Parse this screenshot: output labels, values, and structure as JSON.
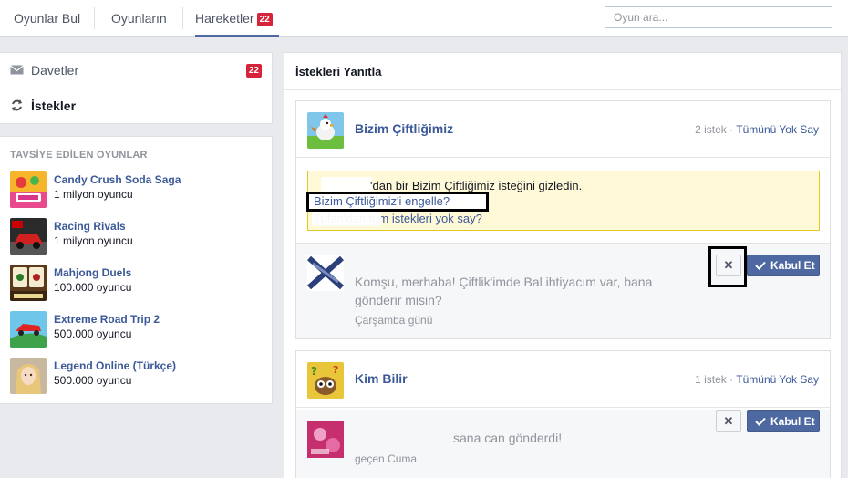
{
  "tabs": {
    "find_games": "Oyunlar Bul",
    "your_games": "Oyunların",
    "activity": "Hareketler",
    "activity_badge": "22"
  },
  "search": {
    "placeholder": "Oyun ara..."
  },
  "leftnav": {
    "invites_label": "Davetler",
    "invites_badge": "22",
    "requests_label": "İstekler"
  },
  "recommended": {
    "title": "TAVSİYE EDİLEN OYUNLAR",
    "games": [
      {
        "name": "Candy Crush Soda Saga",
        "players": "1 milyon oyuncu"
      },
      {
        "name": "Racing Rivals",
        "players": "1 milyon oyuncu"
      },
      {
        "name": "Mahjong Duels",
        "players": "100.000 oyuncu"
      },
      {
        "name": "Extreme Road Trip 2",
        "players": "500.000 oyuncu"
      },
      {
        "name": "Legend Online (Türkçe)",
        "players": "500.000 oyuncu"
      }
    ]
  },
  "main": {
    "title": "İstekleri Yanıtla",
    "cards": [
      {
        "game": "Bizim Çiftliğimiz",
        "count": "2 istek",
        "dismiss_all": "Tümünü Yok Say",
        "notice_line1": "'dan bir Bizim Çiftliğimiz isteğini gizledin.",
        "notice_link1": "Bizim Çiftliğimiz'i engelle?",
        "notice_line3": "Tufan'dan tüm istekleri yok say?",
        "request_text": "Komşu, merhaba! Çiftlik'imde Bal ihtiyacım var, bana gönderir misin?",
        "request_time": "Çarşamba günü",
        "accept_label": "Kabul Et"
      },
      {
        "game": "Kim Bilir",
        "count": "1 istek",
        "dismiss_all": "Tümünü Yok Say",
        "request_text": "sana can gönderdi!",
        "request_time": "geçen Cuma",
        "accept_label": "Kabul Et"
      }
    ]
  },
  "colors": {
    "link": "#3b5998",
    "accent": "#4e69a2",
    "badge": "#d6243b",
    "notice_bg": "#fff9d7"
  }
}
